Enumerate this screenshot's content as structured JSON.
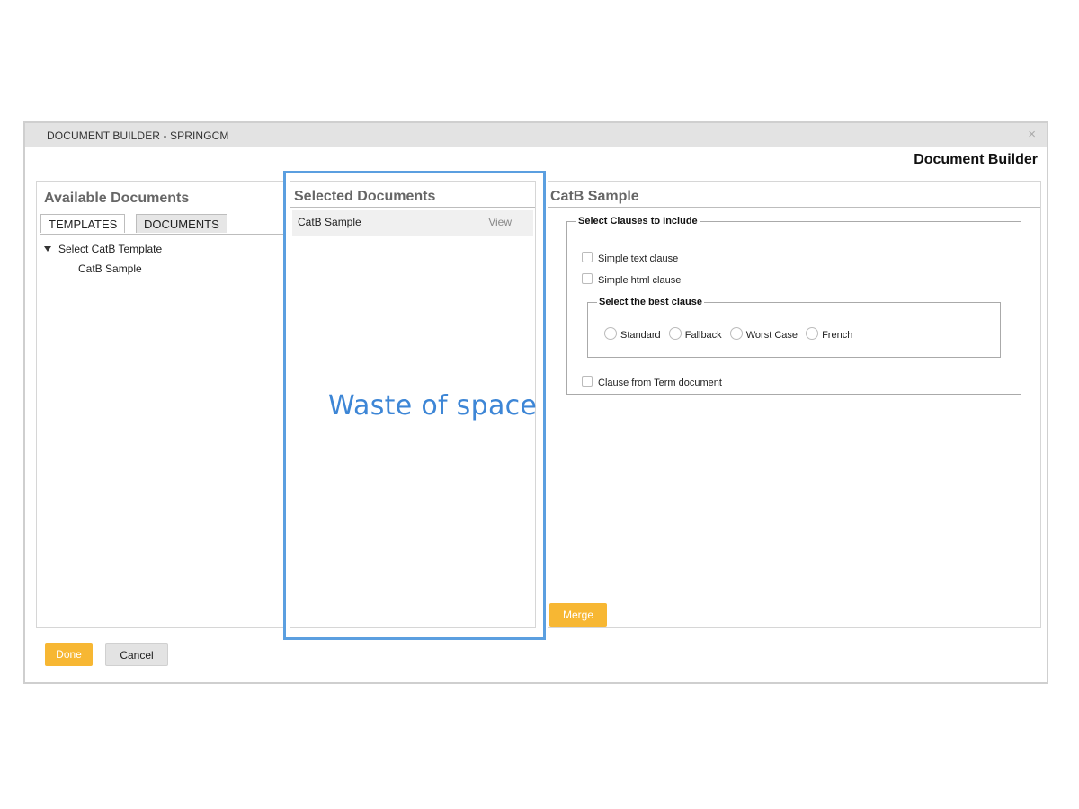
{
  "window": {
    "title": "DOCUMENT BUILDER - SPRINGCM",
    "close_glyph": "×"
  },
  "app_heading": "Document Builder",
  "available": {
    "title": "Available Documents",
    "tabs": [
      {
        "label": "TEMPLATES",
        "active": true
      },
      {
        "label": "DOCUMENTS",
        "active": false
      }
    ],
    "tree": {
      "root": "Select CatB Template",
      "children": [
        "CatB Sample"
      ]
    }
  },
  "selected": {
    "title": "Selected Documents",
    "items": [
      {
        "name": "CatB Sample",
        "action": "View"
      }
    ]
  },
  "detail": {
    "title": "CatB Sample",
    "clauses_legend": "Select Clauses to Include",
    "checkboxes": [
      "Simple text clause",
      "Simple html clause",
      "Clause from Term document"
    ],
    "best_clause_legend": "Select the best clause",
    "radio_options": [
      "Standard",
      "Fallback",
      "Worst Case",
      "French"
    ],
    "merge_label": "Merge"
  },
  "footer": {
    "done_label": "Done",
    "cancel_label": "Cancel"
  },
  "annotation": {
    "text": "Waste of space",
    "color": "#3d86d6"
  },
  "colors": {
    "accent": "#f7b733",
    "highlight": "#5b9fe0"
  }
}
